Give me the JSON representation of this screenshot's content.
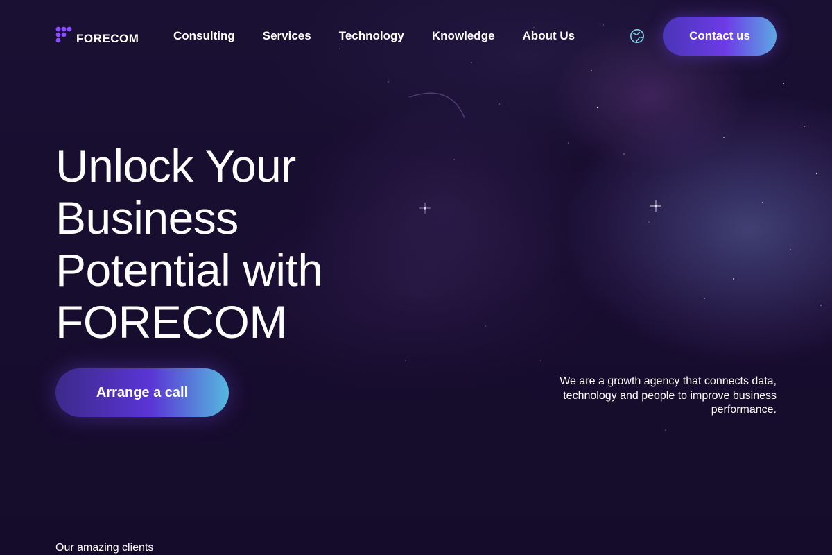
{
  "brand": {
    "name": "FORECOM",
    "accent": "#6d3be6",
    "gradient_end": "#5ea7e3",
    "background": "#150c2b"
  },
  "nav": {
    "items": [
      {
        "label": "Consulting"
      },
      {
        "label": "Services"
      },
      {
        "label": "Technology"
      },
      {
        "label": "Knowledge"
      },
      {
        "label": "About Us"
      }
    ],
    "language_icon": "globe-icon",
    "contact_label": "Contact us"
  },
  "hero": {
    "title_lines": [
      "Unlock Your",
      "Business",
      "Potential with",
      "FORECOM"
    ],
    "cta_label": "Arrange a call",
    "tagline": "We are a growth agency that connects data, technology and people to improve business performance."
  },
  "clients": {
    "label": "Our amazing clients"
  }
}
